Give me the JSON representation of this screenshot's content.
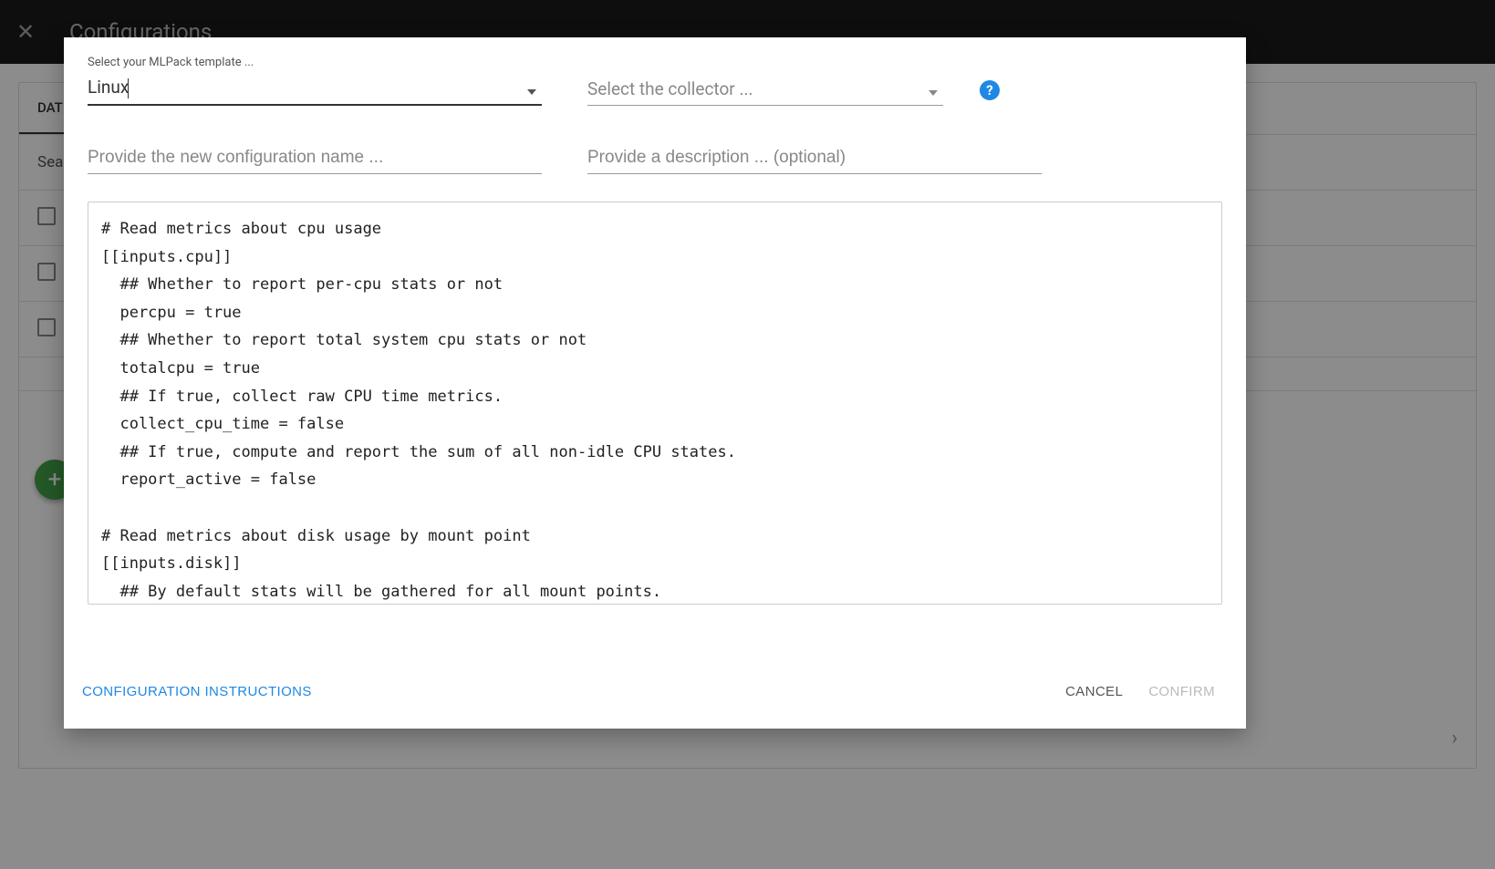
{
  "header": {
    "title": "Configurations"
  },
  "background": {
    "tab": "DAT",
    "searchLabel": "Sea"
  },
  "dialog": {
    "templateLabel": "Select your MLPack template ...",
    "templateValue": "Linux",
    "collectorPlaceholder": "Select the collector ...",
    "configNamePlaceholder": "Provide the new configuration name ...",
    "descriptionPlaceholder": "Provide a description ... (optional)",
    "codeContent": "# Read metrics about cpu usage\n[[inputs.cpu]]\n  ## Whether to report per-cpu stats or not\n  percpu = true\n  ## Whether to report total system cpu stats or not\n  totalcpu = true\n  ## If true, collect raw CPU time metrics.\n  collect_cpu_time = false\n  ## If true, compute and report the sum of all non-idle CPU states.\n  report_active = false\n\n# Read metrics about disk usage by mount point\n[[inputs.disk]]\n  ## By default stats will be gathered for all mount points.",
    "footer": {
      "instructions": "CONFIGURATION INSTRUCTIONS",
      "cancel": "CANCEL",
      "confirm": "CONFIRM"
    }
  }
}
